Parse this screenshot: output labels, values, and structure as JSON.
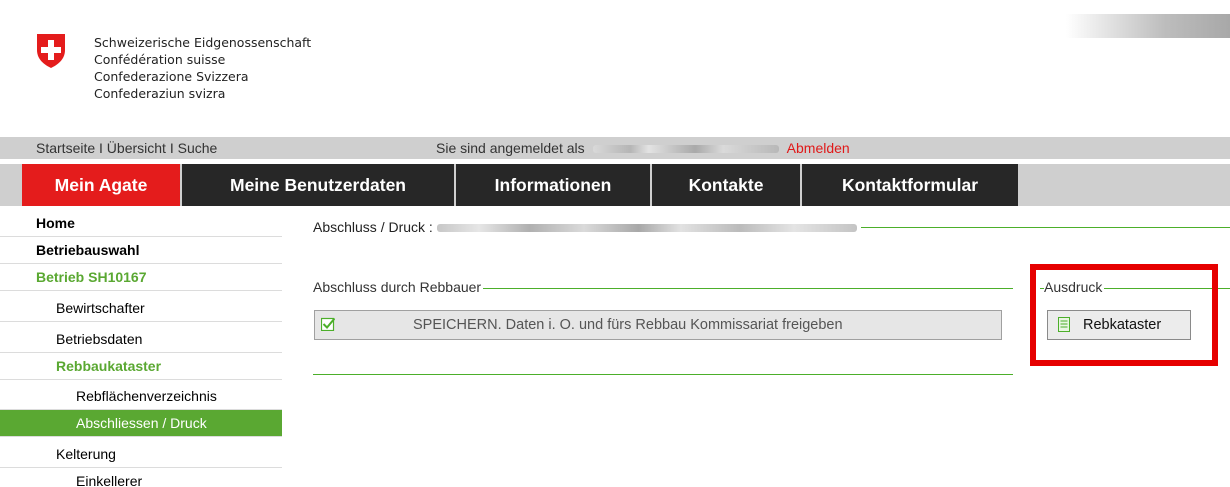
{
  "header": {
    "confederation_lines": [
      "Schweizerische Eidgenossenschaft",
      "Confédération suisse",
      "Confederazione Svizzera",
      "Confederaziun svizra"
    ]
  },
  "metabar": {
    "links": "Startseite I Übersicht I Suche",
    "logged_in_text": "Sie sind angemeldet als",
    "logout_label": "Abmelden"
  },
  "mainnav": {
    "items": [
      {
        "label": "Mein Agate",
        "active": true
      },
      {
        "label": "Meine Benutzerdaten",
        "active": false
      },
      {
        "label": "Informationen",
        "active": false
      },
      {
        "label": "Kontakte",
        "active": false
      },
      {
        "label": "Kontaktformular",
        "active": false
      }
    ]
  },
  "sidenav": {
    "items": [
      {
        "label": "Home"
      },
      {
        "label": "Betriebauswahl"
      },
      {
        "label": "Betrieb SH10167"
      },
      {
        "label": "Bewirtschafter"
      },
      {
        "label": "Betriebsdaten"
      },
      {
        "label": "Rebbaukataster"
      },
      {
        "label": "Rebflächenverzeichnis"
      },
      {
        "label": "Abschliessen / Druck"
      },
      {
        "label": "Kelterung"
      },
      {
        "label": "Einkellerer"
      }
    ]
  },
  "content": {
    "title_prefix": "Abschluss / Druck :",
    "section_rebbauer": "Abschluss durch Rebbauer",
    "save_button_label": "SPEICHERN. Daten i. O. und fürs Rebbau Kommissariat freigeben",
    "section_ausdruck": "Ausdruck",
    "print_button_label": "Rebkataster"
  },
  "colors": {
    "swiss_red": "#e41c1c",
    "nav_dark": "#272727",
    "green": "#5aa832",
    "highlight_red": "#e60000",
    "logout_red": "#e01919"
  },
  "icons": {
    "logo": "swiss-cross-shield",
    "save": "checkbox-icon",
    "print": "document-icon"
  }
}
